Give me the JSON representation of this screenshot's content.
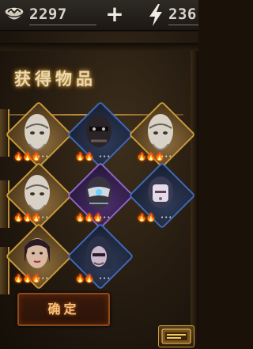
{
  "topbar": {
    "coin_value": "2297",
    "coin_icon": "coin-bowl-icon",
    "add_icon": "plus-icon",
    "energy_icon": "lightning-bolt-icon",
    "energy_value": "236"
  },
  "panel": {
    "title": "获得物品"
  },
  "items": [
    {
      "name": "ghost-elder",
      "rarity": "gold",
      "color": "#c99a3a",
      "stars": "🔥🔥🔥"
    },
    {
      "name": "dark-warrior",
      "rarity": "blue",
      "color": "#3e69b8",
      "stars": "🔥🔥"
    },
    {
      "name": "ghost-elder",
      "rarity": "gold",
      "color": "#c99a3a",
      "stars": "🔥🔥🔥"
    },
    {
      "name": "ghost-elder",
      "rarity": "gold",
      "color": "#c99a3a",
      "stars": "🔥🔥🔥"
    },
    {
      "name": "masked-assassin",
      "rarity": "purple",
      "color": "#8e64c9",
      "stars": "🔥🔥🔥"
    },
    {
      "name": "white-masked-figure",
      "rarity": "blue",
      "color": "#3e69b8",
      "stars": "🔥🔥"
    },
    {
      "name": "female-warrior",
      "rarity": "gold",
      "color": "#c99a3a",
      "stars": "🔥🔥🔥"
    },
    {
      "name": "hooded-rogue",
      "rarity": "blue",
      "color": "#3e69b8",
      "stars": "🔥🔥"
    }
  ],
  "confirm_label": "确定"
}
